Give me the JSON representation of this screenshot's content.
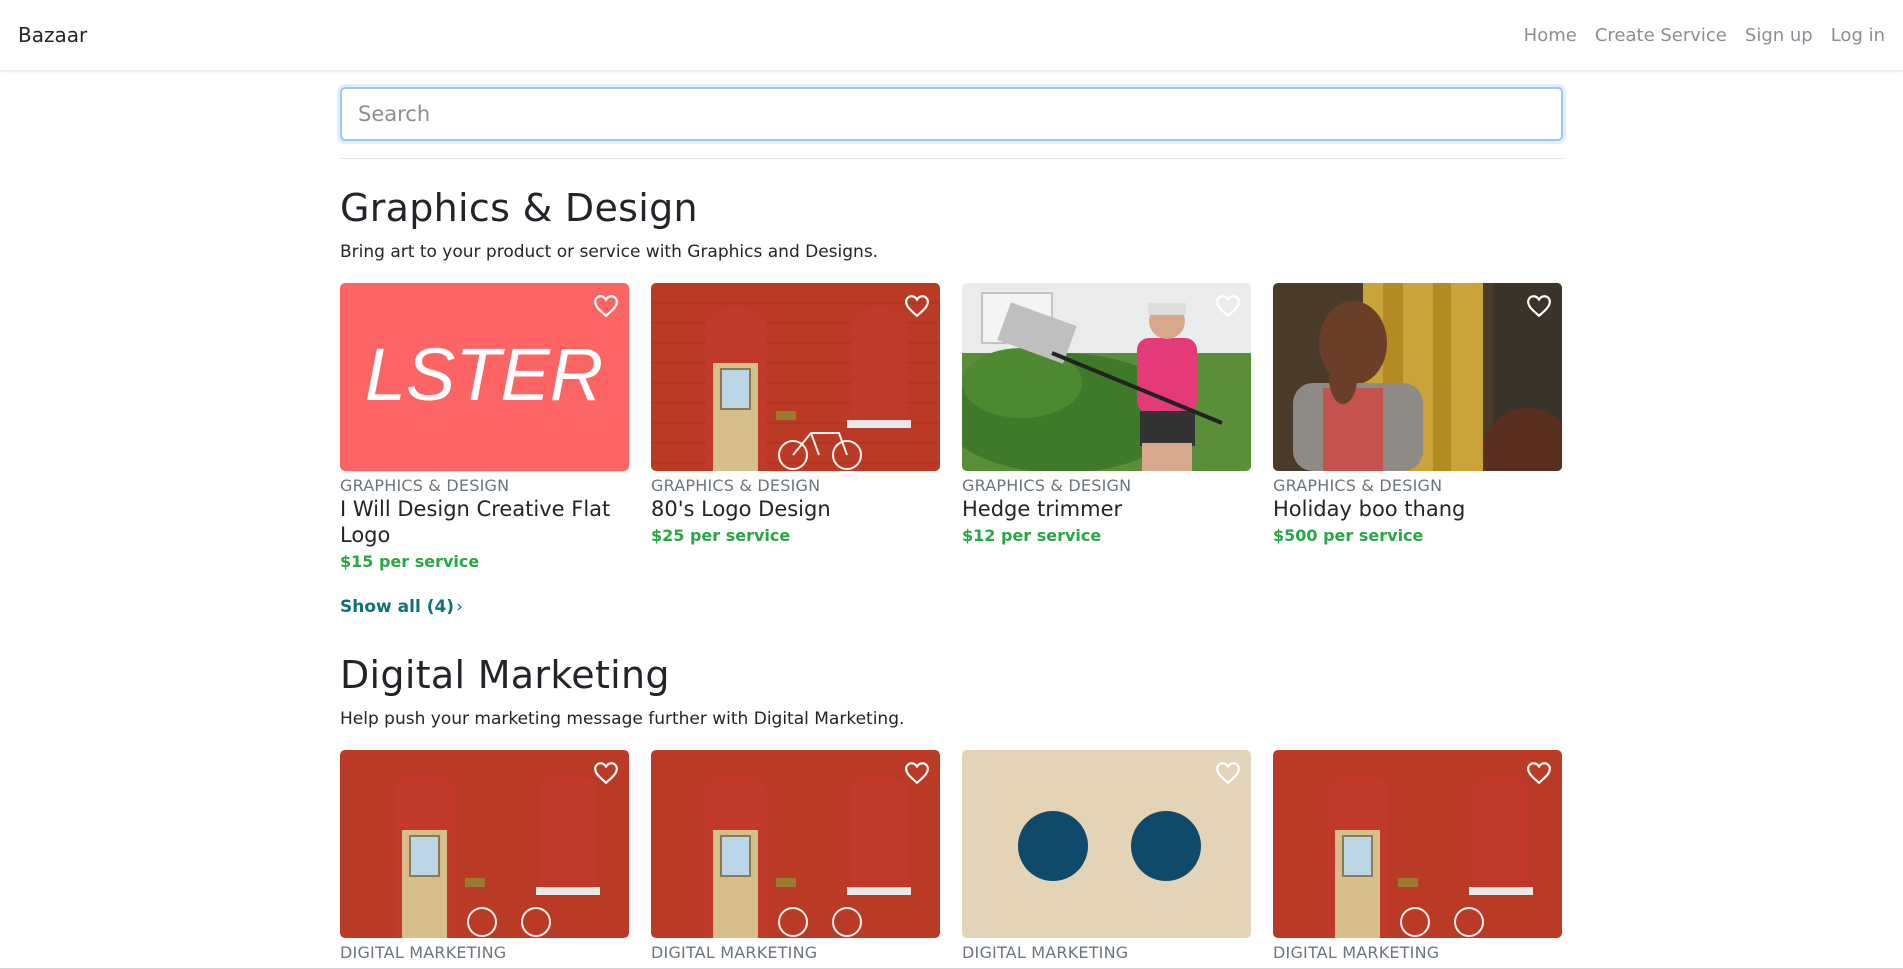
{
  "navbar": {
    "brand": "Bazaar",
    "links": [
      "Home",
      "Create Service",
      "Sign up",
      "Log in"
    ]
  },
  "search": {
    "placeholder": "Search",
    "value": ""
  },
  "sections": [
    {
      "title": "Graphics & Design",
      "description": "Bring art to your product or service with Graphics and Designs.",
      "cards": [
        {
          "category": "GRAPHICS & DESIGN",
          "title": "I Will Design Creative Flat Logo",
          "price": "$15 per service",
          "image": "lster-logo",
          "image_text": "LSTER"
        },
        {
          "category": "GRAPHICS & DESIGN",
          "title": "80's Logo Design",
          "price": "$25 per service",
          "image": "red-brick-door"
        },
        {
          "category": "GRAPHICS & DESIGN",
          "title": "Hedge trimmer",
          "price": "$12 per service",
          "image": "man-mowing-hedge"
        },
        {
          "category": "GRAPHICS & DESIGN",
          "title": "Holiday boo thang",
          "price": "$500 per service",
          "image": "person-face-palm"
        }
      ],
      "show_all": "Show all (4)"
    },
    {
      "title": "Digital Marketing",
      "description": "Help push your marketing message further with Digital Marketing.",
      "cards": [
        {
          "category": "DIGITAL MARKETING",
          "image": "red-brick-door"
        },
        {
          "category": "DIGITAL MARKETING",
          "image": "red-brick-door"
        },
        {
          "category": "DIGITAL MARKETING",
          "image": "blue-dots-sand"
        },
        {
          "category": "DIGITAL MARKETING",
          "image": "red-brick-door"
        }
      ]
    }
  ],
  "colors": {
    "price": "#28a745",
    "link": "#0c7470",
    "muted": "#6c757d",
    "focus_border": "#9ec5fb",
    "lster_bg": "#fd6565"
  }
}
